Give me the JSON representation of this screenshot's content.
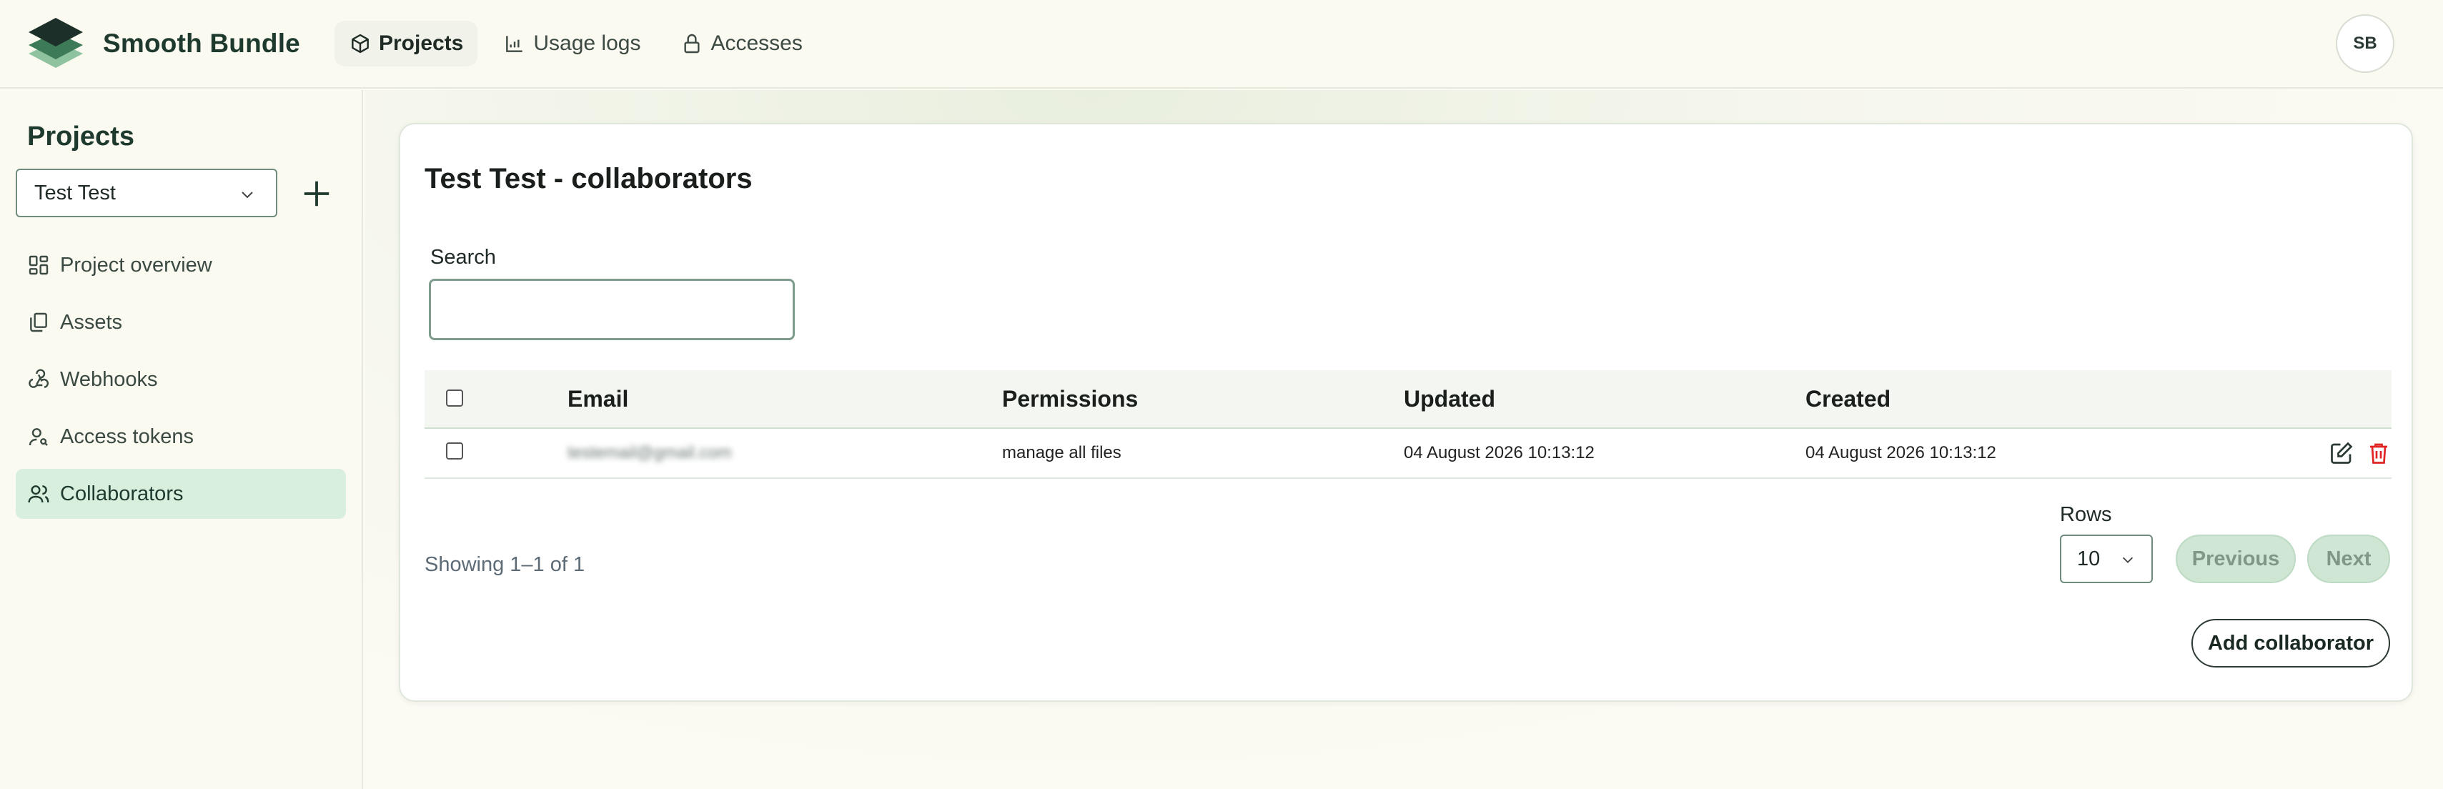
{
  "app": {
    "name": "Smooth Bundle",
    "avatar_initials": "SB"
  },
  "topnav": [
    {
      "label": "Projects",
      "icon": "box-icon",
      "active": true
    },
    {
      "label": "Usage logs",
      "icon": "chart-icon",
      "active": false
    },
    {
      "label": "Accesses",
      "icon": "lock-icon",
      "active": false
    }
  ],
  "sidebar": {
    "title": "Projects",
    "selected_project": "Test Test",
    "items": [
      {
        "label": "Project overview",
        "icon": "grid-icon"
      },
      {
        "label": "Assets",
        "icon": "files-icon"
      },
      {
        "label": "Webhooks",
        "icon": "webhook-icon"
      },
      {
        "label": "Access tokens",
        "icon": "user-key-icon"
      },
      {
        "label": "Collaborators",
        "icon": "users-icon",
        "active": true
      }
    ]
  },
  "main": {
    "title": "Test Test - collaborators",
    "search": {
      "label": "Search",
      "value": "",
      "placeholder": ""
    },
    "table": {
      "headers": [
        "Email",
        "Permissions",
        "Updated",
        "Created"
      ],
      "rows": [
        {
          "email": "testemail@gmail.com",
          "permissions": "manage all files",
          "updated": "04 August 2026 10:13:12",
          "created": "04 August 2026 10:13:12"
        }
      ]
    },
    "showing": "Showing 1–1 of 1",
    "rows_label": "Rows",
    "rows_value": "10",
    "previous_label": "Previous",
    "next_label": "Next",
    "add_button": "Add collaborator"
  },
  "colors": {
    "accent": "#1e3a2e",
    "active_bg": "#d9efde",
    "delete": "#e02424"
  }
}
